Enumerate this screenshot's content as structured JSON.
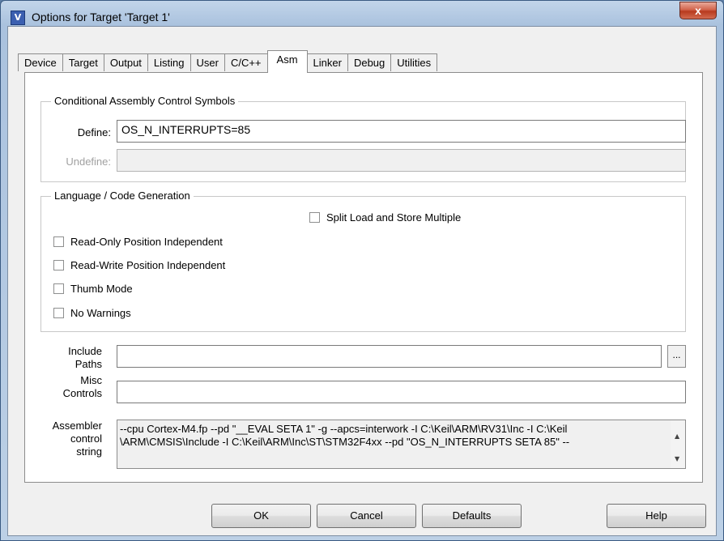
{
  "window": {
    "title": "Options for Target 'Target 1'",
    "close_glyph": "x",
    "app_icon_letter": "V"
  },
  "tabs": [
    {
      "label": "Device"
    },
    {
      "label": "Target"
    },
    {
      "label": "Output"
    },
    {
      "label": "Listing"
    },
    {
      "label": "User"
    },
    {
      "label": "C/C++"
    },
    {
      "label": "Asm"
    },
    {
      "label": "Linker"
    },
    {
      "label": "Debug"
    },
    {
      "label": "Utilities"
    }
  ],
  "active_tab": "Asm",
  "conditional": {
    "legend": "Conditional Assembly Control Symbols",
    "define_label": "Define:",
    "define_value": "OS_N_INTERRUPTS=85",
    "undefine_label": "Undefine:",
    "undefine_value": ""
  },
  "language": {
    "legend": "Language / Code Generation",
    "split_load": {
      "label": "Split Load and Store Multiple",
      "checked": false
    },
    "ropi": {
      "label": "Read-Only Position Independent",
      "checked": false
    },
    "rwpi": {
      "label": "Read-Write Position Independent",
      "checked": false
    },
    "thumb": {
      "label": "Thumb Mode",
      "checked": false
    },
    "nowarn": {
      "label": "No Warnings",
      "checked": false
    }
  },
  "include": {
    "label_line1": "Include",
    "label_line2": "Paths",
    "value": "",
    "browse_label": "..."
  },
  "misc": {
    "label_line1": "Misc",
    "label_line2": "Controls",
    "value": ""
  },
  "asm_string": {
    "label_line1": "Assembler",
    "label_line2": "control",
    "label_line3": "string",
    "line1": "--cpu Cortex-M4.fp --pd \"__EVAL SETA 1\" -g --apcs=interwork -I C:\\Keil\\ARM\\RV31\\Inc -I C:\\Keil",
    "line2": "\\ARM\\CMSIS\\Include -I C:\\Keil\\ARM\\Inc\\ST\\STM32F4xx --pd \"OS_N_INTERRUPTS SETA 85\" --"
  },
  "buttons": {
    "ok": "OK",
    "cancel": "Cancel",
    "defaults": "Defaults",
    "help": "Help"
  }
}
